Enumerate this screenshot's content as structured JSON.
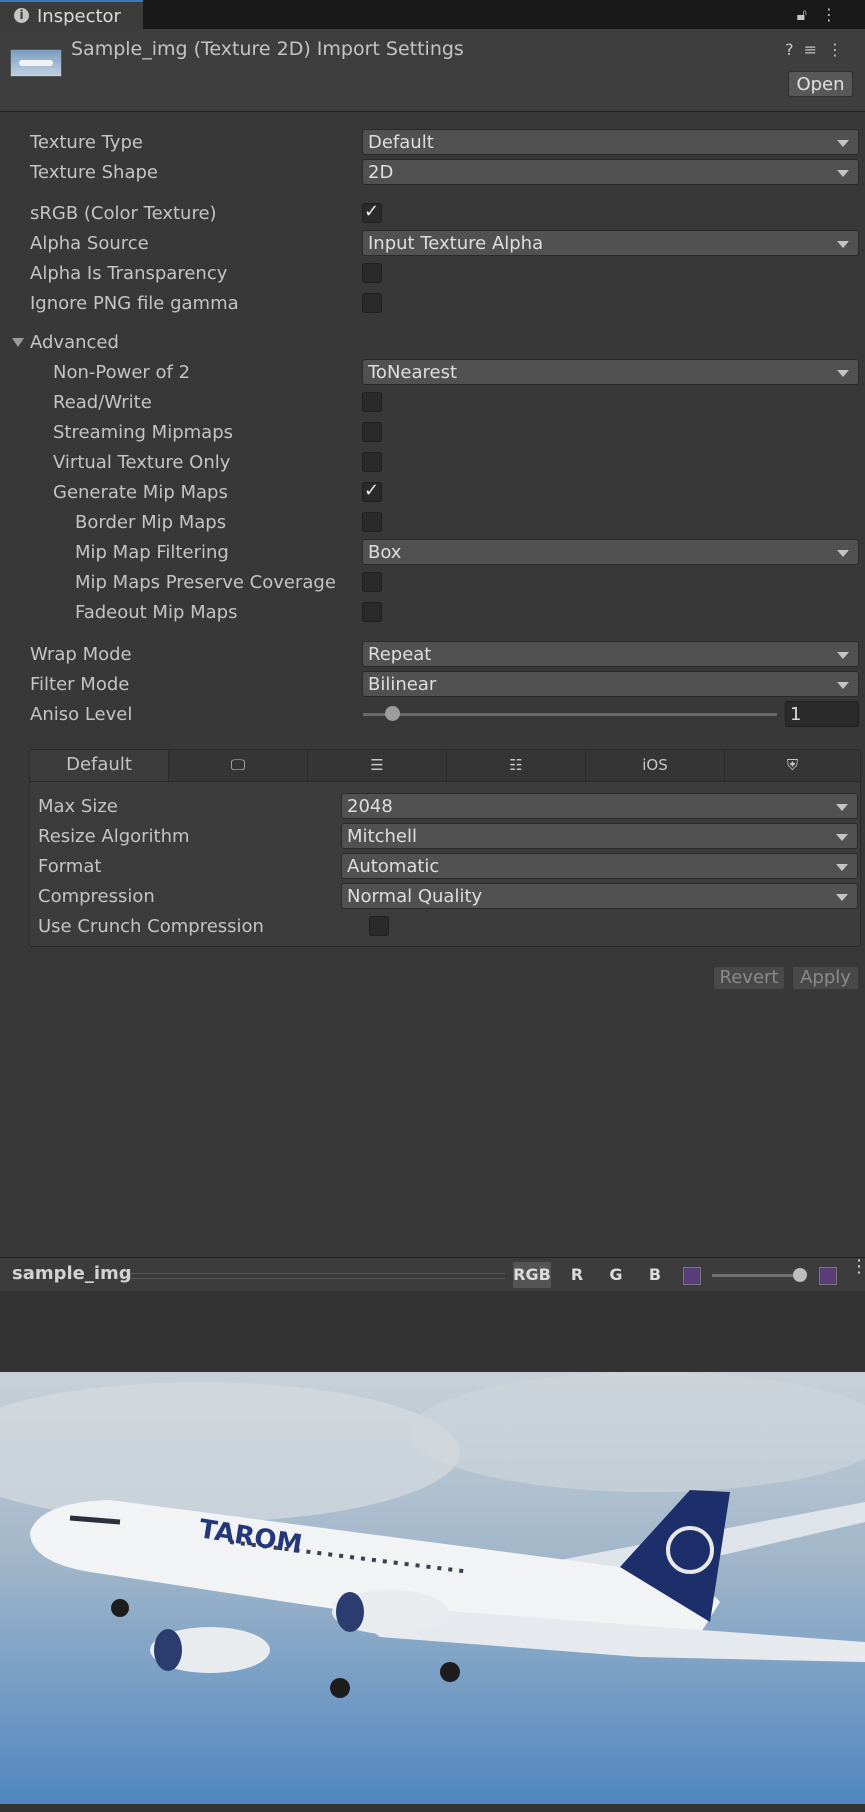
{
  "tab": {
    "title": "Inspector"
  },
  "header": {
    "title": "Sample_img (Texture 2D) Import Settings",
    "open_label": "Open"
  },
  "fields": {
    "texture_type": {
      "label": "Texture Type",
      "value": "Default"
    },
    "texture_shape": {
      "label": "Texture Shape",
      "value": "2D"
    },
    "srgb": {
      "label": "sRGB (Color Texture)",
      "checked": true
    },
    "alpha_source": {
      "label": "Alpha Source",
      "value": "Input Texture Alpha"
    },
    "alpha_is_transparency": {
      "label": "Alpha Is Transparency",
      "checked": false
    },
    "ignore_png_gamma": {
      "label": "Ignore PNG file gamma",
      "checked": false
    }
  },
  "advanced": {
    "label": "Advanced",
    "non_power_of_2": {
      "label": "Non-Power of 2",
      "value": "ToNearest"
    },
    "read_write": {
      "label": "Read/Write",
      "checked": false
    },
    "streaming_mipmaps": {
      "label": "Streaming Mipmaps",
      "checked": false
    },
    "virtual_texture_only": {
      "label": "Virtual Texture Only",
      "checked": false
    },
    "generate_mip_maps": {
      "label": "Generate Mip Maps",
      "checked": true
    },
    "border_mip_maps": {
      "label": "Border Mip Maps",
      "checked": false
    },
    "mip_map_filtering": {
      "label": "Mip Map Filtering",
      "value": "Box"
    },
    "mip_maps_preserve_coverage": {
      "label": "Mip Maps Preserve Coverage",
      "checked": false
    },
    "fadeout_mip_maps": {
      "label": "Fadeout Mip Maps",
      "checked": false
    }
  },
  "wrap_mode": {
    "label": "Wrap Mode",
    "value": "Repeat"
  },
  "filter_mode": {
    "label": "Filter Mode",
    "value": "Bilinear"
  },
  "aniso_level": {
    "label": "Aniso Level",
    "value": "1",
    "slider_fraction": 0.06
  },
  "platform": {
    "tabs": [
      {
        "label": "Default",
        "icon": "default-tab"
      },
      {
        "label": "",
        "icon": "monitor-icon"
      },
      {
        "label": "",
        "icon": "server-icon"
      },
      {
        "label": "",
        "icon": "android-icon"
      },
      {
        "label": "iOS",
        "icon": "ios-tab"
      },
      {
        "label": "",
        "icon": "html5-icon"
      }
    ],
    "max_size": {
      "label": "Max Size",
      "value": "2048"
    },
    "resize_algorithm": {
      "label": "Resize Algorithm",
      "value": "Mitchell"
    },
    "format": {
      "label": "Format",
      "value": "Automatic"
    },
    "compression": {
      "label": "Compression",
      "value": "Normal Quality"
    },
    "use_crunch": {
      "label": "Use Crunch Compression",
      "checked": false
    }
  },
  "actions": {
    "revert": "Revert",
    "apply": "Apply"
  },
  "preview": {
    "name": "sample_img",
    "channels": [
      "RGB",
      "R",
      "G",
      "B"
    ],
    "active_channel": "RGB",
    "image_caption": "TAROM ROMANIAN AIR TRANSPORT aircraft"
  },
  "colors": {
    "panel": "#383838",
    "accent_tab": "#3a79bb",
    "dropdown": "#515151"
  }
}
